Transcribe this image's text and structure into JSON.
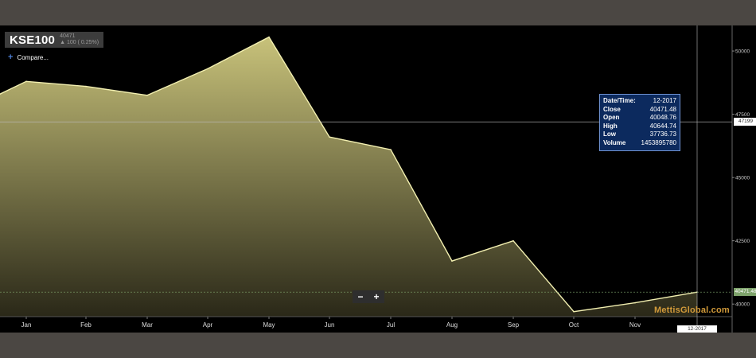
{
  "header": {
    "symbol": "KSE100",
    "price": "40471",
    "change": "▲ 100 ( 0.25%)",
    "compare_label": "Compare...",
    "compare_icon": "plus-icon"
  },
  "tooltip": {
    "rows": [
      {
        "key": "Date/Time:",
        "value": "12-2017"
      },
      {
        "key": "Close",
        "value": "40471.48"
      },
      {
        "key": "Open",
        "value": "40048.76"
      },
      {
        "key": "High",
        "value": "40644.74"
      },
      {
        "key": "Low",
        "value": "37736.73"
      },
      {
        "key": "Volume",
        "value": "1453895780"
      }
    ]
  },
  "zoom": {
    "minus": "−",
    "plus": "+"
  },
  "watermark": "MettisGlobal.com",
  "price_tags": {
    "hover": "47199",
    "last": "40471.48"
  },
  "date_tag": "12-2017",
  "colors": {
    "line": "#f2efb0",
    "fill_top": "#c8c27a",
    "fill_bottom": "#2a2818",
    "background": "#000000",
    "frame": "#4b4743",
    "last_price_tag": "#7ea36b",
    "watermark": "#d19a3a"
  },
  "chart_data": {
    "type": "area",
    "title": "KSE100",
    "xlabel": "",
    "ylabel": "",
    "categories": [
      "Dec",
      "Jan",
      "Feb",
      "Mar",
      "Apr",
      "May",
      "Jun",
      "Jul",
      "Aug",
      "Sep",
      "Oct",
      "Nov",
      "Dec"
    ],
    "x_tick_labels": [
      "Jan",
      "Feb",
      "Mar",
      "Apr",
      "May",
      "Jun",
      "Jul",
      "Aug",
      "Sep",
      "Oct",
      "Nov"
    ],
    "series": [
      {
        "values": [
          48300,
          48800,
          48600,
          48250,
          49300,
          50550,
          46600,
          46100,
          41700,
          42500,
          39700,
          40050,
          40471.48
        ]
      }
    ],
    "y_ticks": [
      40000,
      42500,
      45000,
      47500,
      50000
    ],
    "ylim": [
      39440,
      50820
    ],
    "crosshair_value": 47199,
    "last_value": 40471.48,
    "grid": false,
    "legend": "none"
  }
}
